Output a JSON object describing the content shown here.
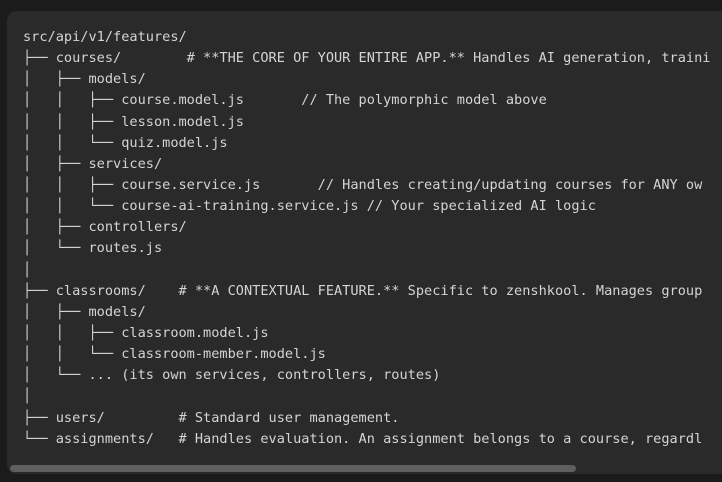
{
  "code_block": {
    "language": "text",
    "lines": [
      "src/api/v1/features/",
      "├── courses/        # **THE CORE OF YOUR ENTIRE APP.** Handles AI generation, traini",
      "│   ├── models/",
      "│   │   ├── course.model.js       // The polymorphic model above",
      "│   │   ├── lesson.model.js",
      "│   │   └── quiz.model.js",
      "│   ├── services/",
      "│   │   ├── course.service.js       // Handles creating/updating courses for ANY ow",
      "│   │   └── course-ai-training.service.js // Your specialized AI logic",
      "│   ├── controllers/",
      "│   └── routes.js",
      "│",
      "├── classrooms/    # **A CONTEXTUAL FEATURE.** Specific to zenshkool. Manages group",
      "│   ├── models/",
      "│   │   ├── classroom.model.js",
      "│   │   └── classroom-member.model.js",
      "│   └── ... (its own services, controllers, routes)",
      "│",
      "├── users/         # Standard user management.",
      "└── assignments/   # Handles evaluation. An assignment belongs to a course, regardl"
    ]
  }
}
